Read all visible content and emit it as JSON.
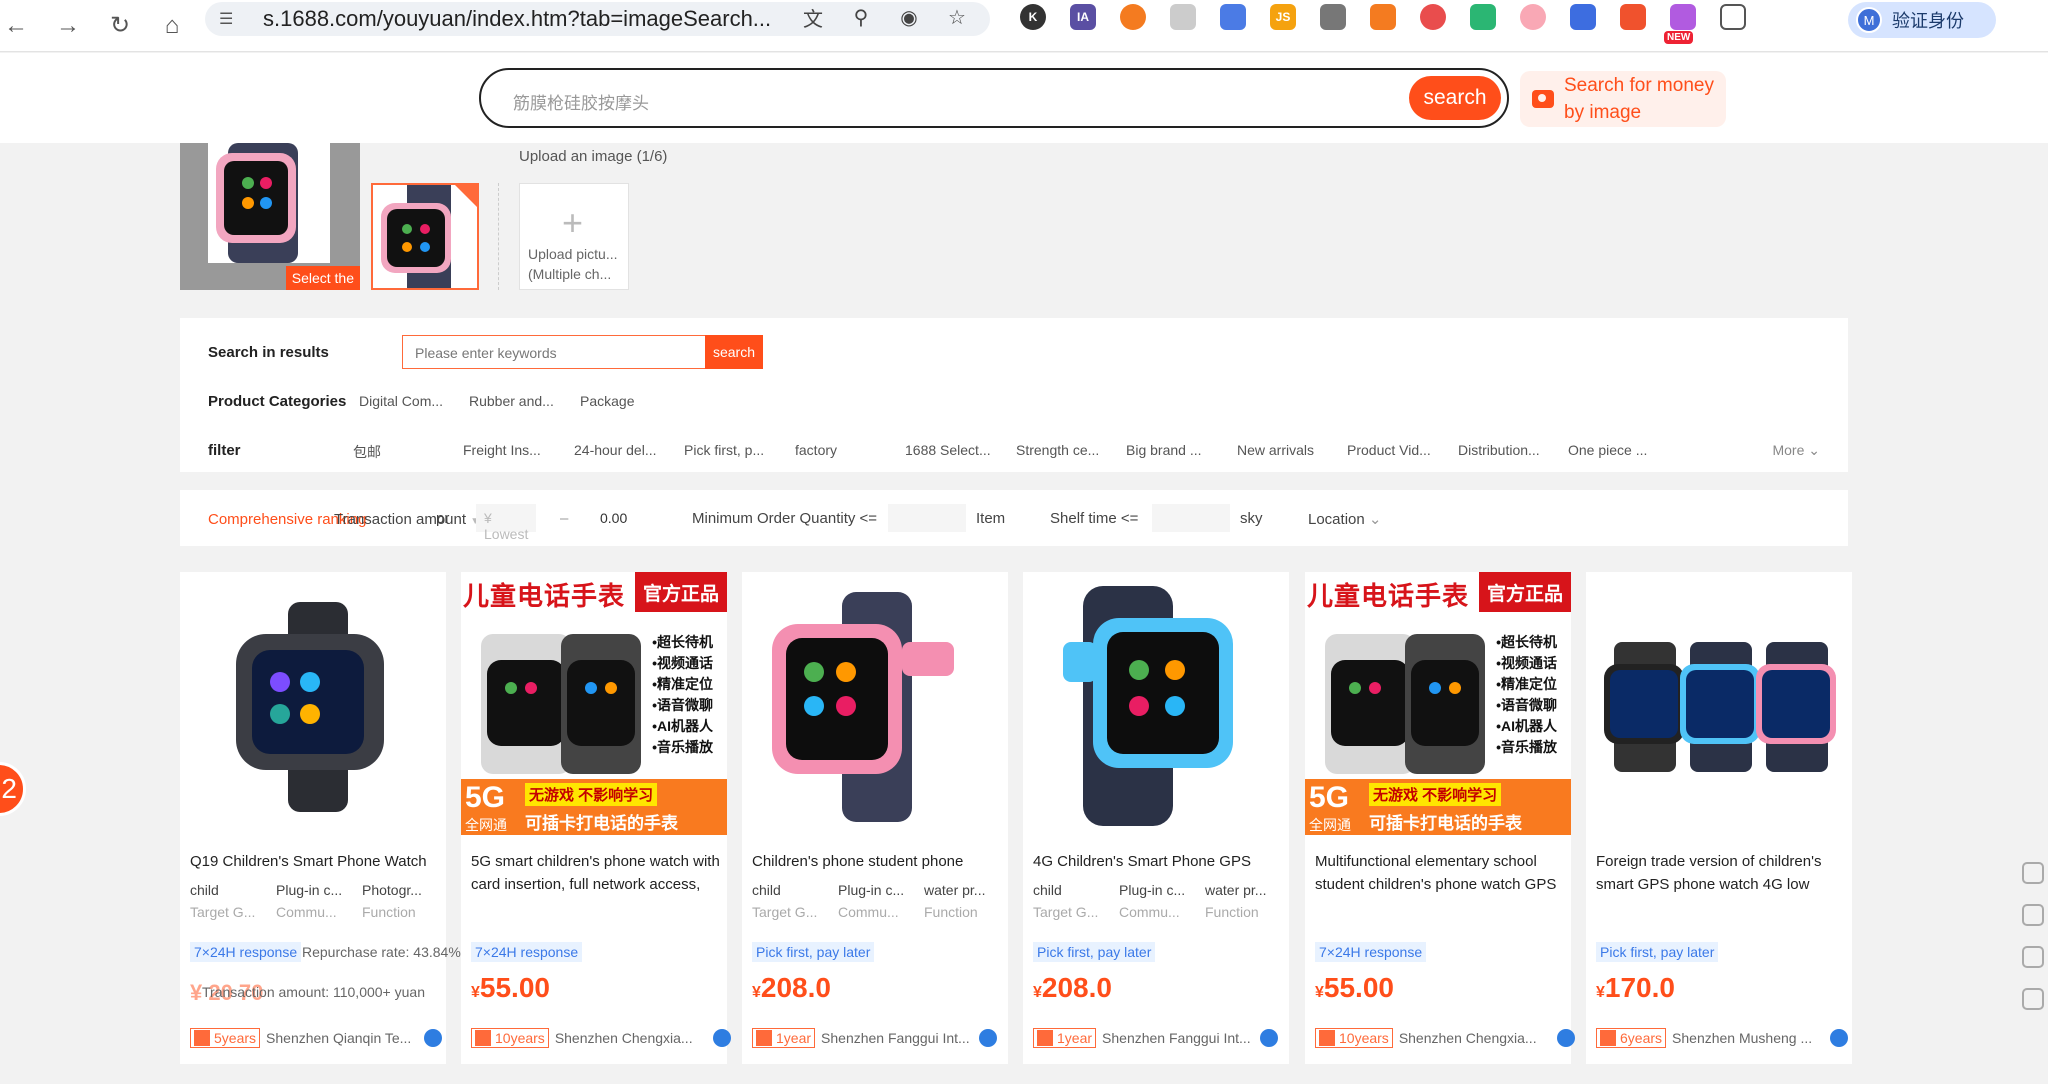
{
  "browser": {
    "url": "s.1688.com/youyuan/index.htm?tab=imageSearch...",
    "profile_initial": "M",
    "profile_label": "验证身份",
    "new_badge": "NEW",
    "ext_labels": {
      "k": "K",
      "ia": "IA",
      "js": "JS"
    }
  },
  "search": {
    "placeholder": "筋膜枪硅胶按摩头",
    "button": "search",
    "image_search": "Search for money by image"
  },
  "images": {
    "select_tag": "Select the",
    "upload_title": "Upload an image (1/6)",
    "upload_line1": "Upload pictu...",
    "upload_line2": "(Multiple ch..."
  },
  "filters": {
    "search_in_results": "Search in results",
    "keyword_placeholder": "Please enter keywords",
    "search_btn": "search",
    "categories_label": "Product Categories",
    "categories": [
      "Digital Com...",
      "Rubber and...",
      "Package"
    ],
    "filter_label": "filter",
    "filter_items": [
      "包邮",
      "Freight Ins...",
      "24-hour del...",
      "Pick first, p...",
      "factory",
      "1688 Select...",
      "Strength ce...",
      "Big brand ...",
      "New arrivals",
      "Product Vid...",
      "Distribution...",
      "One piece ..."
    ],
    "more": "More"
  },
  "sort": {
    "comprehensive": "Comprehensive ranking",
    "transaction": "Transaction amount",
    "pr": "pr",
    "lowest": "¥ Lowest",
    "dash": "–",
    "highest": "0.00",
    "moq_label": "Minimum Order Quantity <=",
    "moq_unit": "Item",
    "shelf_label": "Shelf time <=",
    "shelf_unit": "sky",
    "location": "Location"
  },
  "products": [
    {
      "title": "Q19 Children's Smart Phone Watch",
      "attrs": [
        [
          "child",
          "Target G..."
        ],
        [
          "Plug-in c...",
          "Commu..."
        ],
        [
          "Photogr...",
          "Function"
        ]
      ],
      "badge": "7×24H response",
      "repurchase": "Repurchase rate: 43.84%",
      "price_partial": "¥ 20 70",
      "transaction": "Transaction amount: 110,000+ yuan",
      "years": "5years",
      "company": "Shenzhen Qianqin Te..."
    },
    {
      "title": "5G smart children's phone watch with card insertion, full network access,",
      "attrs": [],
      "badge": "7×24H response",
      "price": "55.00",
      "years": "10years",
      "company": "Shenzhen Chengxia..."
    },
    {
      "title": "Children's phone student phone",
      "attrs": [
        [
          "child",
          "Target G..."
        ],
        [
          "Plug-in c...",
          "Commu..."
        ],
        [
          "water pr...",
          "Function"
        ]
      ],
      "badge": "Pick first, pay later",
      "price": "208.0",
      "years": "1year",
      "company": "Shenzhen Fanggui Int..."
    },
    {
      "title": "4G Children's Smart Phone GPS",
      "attrs": [
        [
          "child",
          "Target G..."
        ],
        [
          "Plug-in c...",
          "Commu..."
        ],
        [
          "water pr...",
          "Function"
        ]
      ],
      "badge": "Pick first, pay later",
      "price": "208.0",
      "years": "1year",
      "company": "Shenzhen Fanggui Int..."
    },
    {
      "title": "Multifunctional elementary school student children's phone watch GPS",
      "attrs": [],
      "badge": "7×24H response",
      "price": "55.00",
      "years": "10years",
      "company": "Shenzhen Chengxia..."
    },
    {
      "title": "Foreign trade version of children's smart GPS phone watch 4G low",
      "attrs": [],
      "badge": "Pick first, pay later",
      "price": "170.0",
      "years": "6years",
      "company": "Shenzhen Musheng ..."
    }
  ],
  "poster": {
    "headline": "儿童电话手表",
    "official": "官方正品",
    "features": [
      "•超长待机",
      "•视频通话",
      "•精准定位",
      "•语音微聊",
      "•AI机器人",
      "•音乐播放"
    ],
    "g5": "5G",
    "net": "全网通",
    "line1": "无游戏 不影响学习",
    "line2": "可插卡打电话的手表"
  },
  "currency": "¥",
  "float_badge": "2",
  "colors": {
    "accent": "#ff4e1a",
    "badge_blue": "#3b79e8"
  }
}
